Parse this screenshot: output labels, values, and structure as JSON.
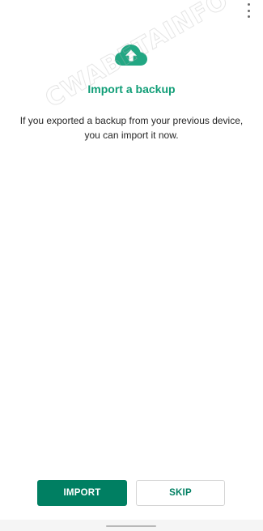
{
  "icons": {
    "menu": "more-vert-icon",
    "hero": "cloud-upload-icon"
  },
  "watermark": "CWABETAINFO",
  "content": {
    "title": "Import a backup",
    "description": "If you exported a backup from your previous device, you can import it now."
  },
  "actions": {
    "import_label": "IMPORT",
    "skip_label": "SKIP"
  },
  "colors": {
    "accent": "#0f9d76",
    "primary_button": "#007f62",
    "text": "#262626",
    "background": "#ffffff"
  }
}
